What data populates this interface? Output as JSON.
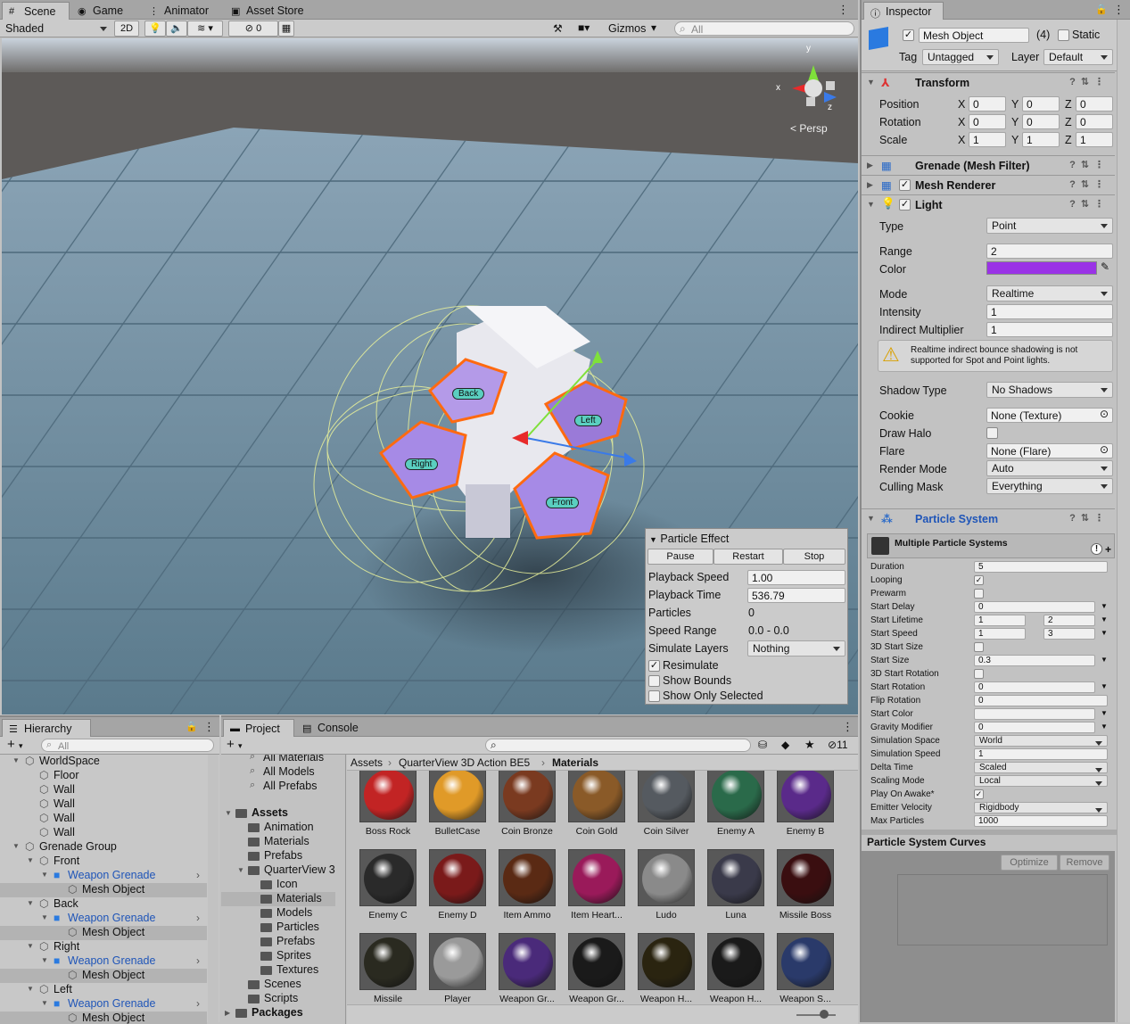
{
  "scene_tabs": [
    {
      "label": "Scene",
      "icon": "grid-icon"
    },
    {
      "label": "Game",
      "icon": "gamepad-icon"
    },
    {
      "label": "Animator",
      "icon": "animator-icon"
    },
    {
      "label": "Asset Store",
      "icon": "store-icon"
    }
  ],
  "scene_toolbar": {
    "shading": "Shaded",
    "mode2d": "2D",
    "hidden_count": "0",
    "gizmos": "Gizmos",
    "search_placeholder": "All"
  },
  "scene_view": {
    "persp": "Persp",
    "axis_x": "x",
    "axis_y": "y",
    "axis_z": "z",
    "labels": [
      "Back",
      "Left",
      "Right",
      "Front"
    ]
  },
  "particle_effect": {
    "title": "Particle Effect",
    "buttons": [
      "Pause",
      "Restart",
      "Stop"
    ],
    "playback_speed_label": "Playback Speed",
    "playback_speed": "1.00",
    "playback_time_label": "Playback Time",
    "playback_time": "536.79",
    "particles_label": "Particles",
    "particles": "0",
    "speed_range_label": "Speed Range",
    "speed_range": "0.0 - 0.0",
    "simulate_layers_label": "Simulate Layers",
    "simulate_layers": "Nothing",
    "resimulate": "Resimulate",
    "show_bounds": "Show Bounds",
    "show_only_selected": "Show Only Selected"
  },
  "inspector": {
    "tab": "Inspector",
    "object_name": "Mesh Object",
    "count": "(4)",
    "static": "Static",
    "tag_label": "Tag",
    "tag": "Untagged",
    "layer_label": "Layer",
    "layer": "Default",
    "transform": {
      "title": "Transform",
      "rows": [
        {
          "label": "Position",
          "x": "0",
          "y": "0",
          "z": "0"
        },
        {
          "label": "Rotation",
          "x": "0",
          "y": "0",
          "z": "0"
        },
        {
          "label": "Scale",
          "x": "1",
          "y": "1",
          "z": "1"
        }
      ]
    },
    "mesh_filter": "Grenade (Mesh Filter)",
    "mesh_renderer": "Mesh Renderer",
    "light": {
      "title": "Light",
      "type_label": "Type",
      "type": "Point",
      "range_label": "Range",
      "range": "2",
      "color_label": "Color",
      "color": "#9a32e6",
      "mode_label": "Mode",
      "mode": "Realtime",
      "intensity_label": "Intensity",
      "intensity": "1",
      "indirect_label": "Indirect Multiplier",
      "indirect": "1",
      "warning": "Realtime indirect bounce shadowing is not supported for Spot and Point lights.",
      "shadow_label": "Shadow Type",
      "shadow": "No Shadows",
      "cookie_label": "Cookie",
      "cookie": "None (Texture)",
      "halo_label": "Draw Halo",
      "flare_label": "Flare",
      "flare": "None (Flare)",
      "render_label": "Render Mode",
      "render": "Auto",
      "culling_label": "Culling Mask",
      "culling": "Everything"
    },
    "particle_system": {
      "title": "Particle System",
      "sub": "Multiple Particle Systems",
      "rows": [
        {
          "label": "Duration",
          "v": "5"
        },
        {
          "label": "Looping",
          "check": true
        },
        {
          "label": "Prewarm",
          "check": false
        },
        {
          "label": "Start Delay",
          "v": "0"
        },
        {
          "label": "Start Lifetime",
          "v": "1",
          "v2": "2"
        },
        {
          "label": "Start Speed",
          "v": "1",
          "v2": "3"
        },
        {
          "label": "3D Start Size",
          "check": false
        },
        {
          "label": "Start Size",
          "v": "0.3"
        },
        {
          "label": "3D Start Rotation",
          "check": false
        },
        {
          "label": "Start Rotation",
          "v": "0"
        },
        {
          "label": "Flip Rotation",
          "v": "0"
        },
        {
          "label": "Start Color",
          "v": ""
        },
        {
          "label": "Gravity Modifier",
          "v": "0"
        },
        {
          "label": "Simulation Space",
          "v": "World"
        },
        {
          "label": "Simulation Speed",
          "v": "1"
        },
        {
          "label": "Delta Time",
          "v": "Scaled"
        },
        {
          "label": "Scaling Mode",
          "v": "Local"
        },
        {
          "label": "Play On Awake*",
          "check": true
        },
        {
          "label": "Emitter Velocity",
          "v": "Rigidbody"
        },
        {
          "label": "Max Particles",
          "v": "1000"
        }
      ]
    },
    "curves": {
      "title": "Particle System Curves",
      "optimize": "Optimize",
      "remove": "Remove"
    }
  },
  "hierarchy": {
    "tab": "Hierarchy",
    "search_placeholder": "All",
    "items": [
      {
        "label": "WorldSpace",
        "depth": 0
      },
      {
        "label": "Floor",
        "depth": 1
      },
      {
        "label": "Wall",
        "depth": 1
      },
      {
        "label": "Wall",
        "depth": 1
      },
      {
        "label": "Wall",
        "depth": 1
      },
      {
        "label": "Wall",
        "depth": 1
      },
      {
        "label": "Grenade Group",
        "depth": 0
      },
      {
        "label": "Front",
        "depth": 1
      },
      {
        "label": "Weapon Grenade",
        "depth": 2
      },
      {
        "label": "Mesh Object",
        "depth": 3
      },
      {
        "label": "Back",
        "depth": 1
      },
      {
        "label": "Weapon Grenade",
        "depth": 2
      },
      {
        "label": "Mesh Object",
        "depth": 3
      },
      {
        "label": "Right",
        "depth": 1
      },
      {
        "label": "Weapon Grenade",
        "depth": 2
      },
      {
        "label": "Mesh Object",
        "depth": 3
      },
      {
        "label": "Left",
        "depth": 1
      },
      {
        "label": "Weapon Grenade",
        "depth": 2
      },
      {
        "label": "Mesh Object",
        "depth": 3
      }
    ]
  },
  "project": {
    "tab": "Project",
    "console_tab": "Console",
    "hidden_count": "11",
    "breadcrumb": [
      "Assets",
      "QuarterView 3D Action BE5",
      "Materials"
    ],
    "favorites": [
      "All Materials",
      "All Models",
      "All Prefabs"
    ],
    "folders": [
      {
        "label": "Assets",
        "depth": 0
      },
      {
        "label": "Animation",
        "depth": 1
      },
      {
        "label": "Materials",
        "depth": 1
      },
      {
        "label": "Prefabs",
        "depth": 1
      },
      {
        "label": "QuarterView 3",
        "depth": 1
      },
      {
        "label": "Icon",
        "depth": 2
      },
      {
        "label": "Materials",
        "depth": 2
      },
      {
        "label": "Models",
        "depth": 2
      },
      {
        "label": "Particles",
        "depth": 2
      },
      {
        "label": "Prefabs",
        "depth": 2
      },
      {
        "label": "Sprites",
        "depth": 2
      },
      {
        "label": "Textures",
        "depth": 2
      },
      {
        "label": "Scenes",
        "depth": 1
      },
      {
        "label": "Scripts",
        "depth": 1
      },
      {
        "label": "Packages",
        "depth": 0
      }
    ],
    "materials": [
      {
        "label": "Boss Rock",
        "color": "#c22424"
      },
      {
        "label": "BulletCase",
        "color": "#e09a28"
      },
      {
        "label": "Coin Bronze",
        "color": "#7a3a20"
      },
      {
        "label": "Coin Gold",
        "color": "#8a5a28"
      },
      {
        "label": "Coin Silver",
        "color": "#555a60"
      },
      {
        "label": "Enemy A",
        "color": "#2a6a4a"
      },
      {
        "label": "Enemy B",
        "color": "#5a2a8a"
      },
      {
        "label": "Enemy C",
        "color": "#2a2a2a"
      },
      {
        "label": "Enemy D",
        "color": "#7a1a1a"
      },
      {
        "label": "Item Ammo",
        "color": "#5a2a14"
      },
      {
        "label": "Item Heart...",
        "color": "#9a1a5a"
      },
      {
        "label": "Ludo",
        "color": "#8a8a8a"
      },
      {
        "label": "Luna",
        "color": "#3a3a4a"
      },
      {
        "label": "Missile Boss",
        "color": "#3a0e10"
      },
      {
        "label": "Missile",
        "color": "#2a2a20"
      },
      {
        "label": "Player",
        "color": "#9a9a9a"
      },
      {
        "label": "Weapon Gr...",
        "color": "#4a2a7a"
      },
      {
        "label": "Weapon Gr...",
        "color": "#1a1a1a"
      },
      {
        "label": "Weapon H...",
        "color": "#2a2410"
      },
      {
        "label": "Weapon H...",
        "color": "#1a1a1a"
      },
      {
        "label": "Weapon S...",
        "color": "#2a3a6a"
      }
    ]
  }
}
